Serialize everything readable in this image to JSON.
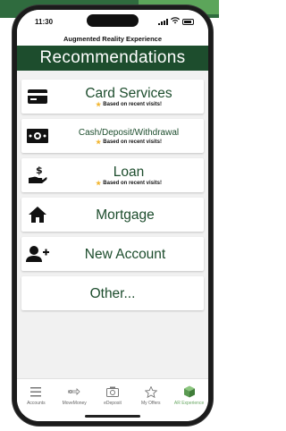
{
  "status": {
    "time": "11:30"
  },
  "app_title": "Augmented Reality Experience",
  "header": {
    "title": "Recommendations"
  },
  "items": [
    {
      "label": "Card Services",
      "sub": "Based on recent visits!",
      "icon": "credit-card-icon"
    },
    {
      "label": "Cash/Deposit/Withdrawal",
      "sub": "Based on recent visits!",
      "icon": "cash-icon"
    },
    {
      "label": "Loan",
      "sub": "Based on recent visits!",
      "icon": "loan-hand-dollar-icon"
    },
    {
      "label": "Mortgage",
      "icon": "house-icon"
    },
    {
      "label": "New Account",
      "icon": "add-person-icon"
    },
    {
      "label": "Other..."
    }
  ],
  "tabs": [
    {
      "label": "Accounts",
      "icon": "list-icon"
    },
    {
      "label": "MoveMoney",
      "icon": "transfer-icon"
    },
    {
      "label": "eDeposit",
      "icon": "camera-icon"
    },
    {
      "label": "My Offers",
      "icon": "star-icon"
    },
    {
      "label": "AR Experience",
      "icon": "cube-icon",
      "active": true
    }
  ],
  "colors": {
    "brand_green": "#1d4d2d",
    "accent_green": "#6aa864",
    "star": "#f2b632"
  }
}
